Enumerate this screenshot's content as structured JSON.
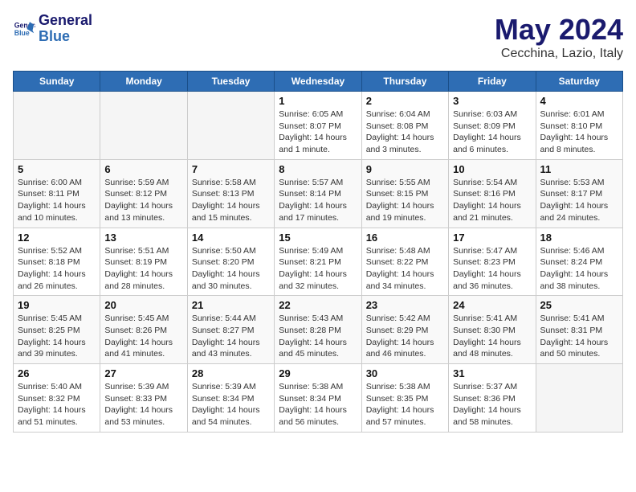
{
  "header": {
    "logo_line1": "General",
    "logo_line2": "Blue",
    "title": "May 2024",
    "subtitle": "Cecchina, Lazio, Italy"
  },
  "days_of_week": [
    "Sunday",
    "Monday",
    "Tuesday",
    "Wednesday",
    "Thursday",
    "Friday",
    "Saturday"
  ],
  "weeks": [
    [
      {
        "day": "",
        "info": ""
      },
      {
        "day": "",
        "info": ""
      },
      {
        "day": "",
        "info": ""
      },
      {
        "day": "1",
        "info": "Sunrise: 6:05 AM\nSunset: 8:07 PM\nDaylight: 14 hours\nand 1 minute."
      },
      {
        "day": "2",
        "info": "Sunrise: 6:04 AM\nSunset: 8:08 PM\nDaylight: 14 hours\nand 3 minutes."
      },
      {
        "day": "3",
        "info": "Sunrise: 6:03 AM\nSunset: 8:09 PM\nDaylight: 14 hours\nand 6 minutes."
      },
      {
        "day": "4",
        "info": "Sunrise: 6:01 AM\nSunset: 8:10 PM\nDaylight: 14 hours\nand 8 minutes."
      }
    ],
    [
      {
        "day": "5",
        "info": "Sunrise: 6:00 AM\nSunset: 8:11 PM\nDaylight: 14 hours\nand 10 minutes."
      },
      {
        "day": "6",
        "info": "Sunrise: 5:59 AM\nSunset: 8:12 PM\nDaylight: 14 hours\nand 13 minutes."
      },
      {
        "day": "7",
        "info": "Sunrise: 5:58 AM\nSunset: 8:13 PM\nDaylight: 14 hours\nand 15 minutes."
      },
      {
        "day": "8",
        "info": "Sunrise: 5:57 AM\nSunset: 8:14 PM\nDaylight: 14 hours\nand 17 minutes."
      },
      {
        "day": "9",
        "info": "Sunrise: 5:55 AM\nSunset: 8:15 PM\nDaylight: 14 hours\nand 19 minutes."
      },
      {
        "day": "10",
        "info": "Sunrise: 5:54 AM\nSunset: 8:16 PM\nDaylight: 14 hours\nand 21 minutes."
      },
      {
        "day": "11",
        "info": "Sunrise: 5:53 AM\nSunset: 8:17 PM\nDaylight: 14 hours\nand 24 minutes."
      }
    ],
    [
      {
        "day": "12",
        "info": "Sunrise: 5:52 AM\nSunset: 8:18 PM\nDaylight: 14 hours\nand 26 minutes."
      },
      {
        "day": "13",
        "info": "Sunrise: 5:51 AM\nSunset: 8:19 PM\nDaylight: 14 hours\nand 28 minutes."
      },
      {
        "day": "14",
        "info": "Sunrise: 5:50 AM\nSunset: 8:20 PM\nDaylight: 14 hours\nand 30 minutes."
      },
      {
        "day": "15",
        "info": "Sunrise: 5:49 AM\nSunset: 8:21 PM\nDaylight: 14 hours\nand 32 minutes."
      },
      {
        "day": "16",
        "info": "Sunrise: 5:48 AM\nSunset: 8:22 PM\nDaylight: 14 hours\nand 34 minutes."
      },
      {
        "day": "17",
        "info": "Sunrise: 5:47 AM\nSunset: 8:23 PM\nDaylight: 14 hours\nand 36 minutes."
      },
      {
        "day": "18",
        "info": "Sunrise: 5:46 AM\nSunset: 8:24 PM\nDaylight: 14 hours\nand 38 minutes."
      }
    ],
    [
      {
        "day": "19",
        "info": "Sunrise: 5:45 AM\nSunset: 8:25 PM\nDaylight: 14 hours\nand 39 minutes."
      },
      {
        "day": "20",
        "info": "Sunrise: 5:45 AM\nSunset: 8:26 PM\nDaylight: 14 hours\nand 41 minutes."
      },
      {
        "day": "21",
        "info": "Sunrise: 5:44 AM\nSunset: 8:27 PM\nDaylight: 14 hours\nand 43 minutes."
      },
      {
        "day": "22",
        "info": "Sunrise: 5:43 AM\nSunset: 8:28 PM\nDaylight: 14 hours\nand 45 minutes."
      },
      {
        "day": "23",
        "info": "Sunrise: 5:42 AM\nSunset: 8:29 PM\nDaylight: 14 hours\nand 46 minutes."
      },
      {
        "day": "24",
        "info": "Sunrise: 5:41 AM\nSunset: 8:30 PM\nDaylight: 14 hours\nand 48 minutes."
      },
      {
        "day": "25",
        "info": "Sunrise: 5:41 AM\nSunset: 8:31 PM\nDaylight: 14 hours\nand 50 minutes."
      }
    ],
    [
      {
        "day": "26",
        "info": "Sunrise: 5:40 AM\nSunset: 8:32 PM\nDaylight: 14 hours\nand 51 minutes."
      },
      {
        "day": "27",
        "info": "Sunrise: 5:39 AM\nSunset: 8:33 PM\nDaylight: 14 hours\nand 53 minutes."
      },
      {
        "day": "28",
        "info": "Sunrise: 5:39 AM\nSunset: 8:34 PM\nDaylight: 14 hours\nand 54 minutes."
      },
      {
        "day": "29",
        "info": "Sunrise: 5:38 AM\nSunset: 8:34 PM\nDaylight: 14 hours\nand 56 minutes."
      },
      {
        "day": "30",
        "info": "Sunrise: 5:38 AM\nSunset: 8:35 PM\nDaylight: 14 hours\nand 57 minutes."
      },
      {
        "day": "31",
        "info": "Sunrise: 5:37 AM\nSunset: 8:36 PM\nDaylight: 14 hours\nand 58 minutes."
      },
      {
        "day": "",
        "info": ""
      }
    ]
  ]
}
